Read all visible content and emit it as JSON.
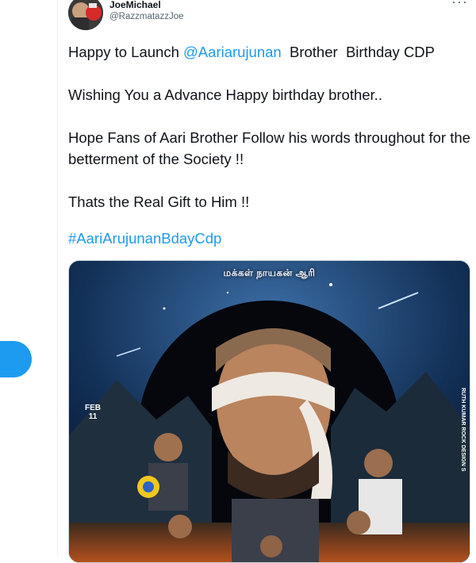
{
  "tweet": {
    "author_name": "JoeMichael",
    "author_handle": "@RazzmatazzJoe",
    "more_label": "···",
    "line1_prefix": "Happy to Launch ",
    "line1_mention": "@Aariarujunan",
    "line1_suffix": "  Brother  Birthday CDP",
    "line2": "Wishing You a Advance Happy birthday brother..",
    "line3": "Hope Fans of Aari Brother Follow his words throughout for the betterment of the Society !!",
    "line4": "Thats the Real Gift to Him !!",
    "hashtag": "#AariArujunanBdayCdp"
  },
  "poster": {
    "title": "மக்கள் நாயகன் ஆரி",
    "date_month": "FEB",
    "date_day": "11",
    "credit": "RUTH KUMAR ROCK DESIGN S"
  },
  "colors": {
    "link": "#1d9bf0",
    "text": "#0f1419",
    "secondary": "#536471",
    "tweet_button": "#1d9bf0"
  }
}
